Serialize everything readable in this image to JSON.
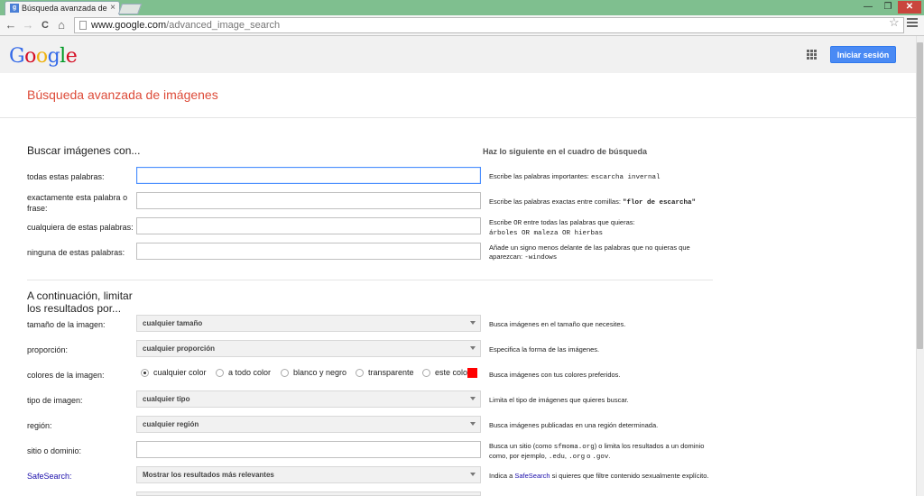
{
  "browser": {
    "tab_title": "Búsqueda avanzada de imágenes",
    "tab_favicon_letter": "g",
    "tab_close": "×",
    "url_domain": "www.google.com",
    "url_path": "/advanced_image_search",
    "controls": {
      "minimize": "—",
      "maximize": "❐",
      "close": "✕"
    },
    "nav": {
      "back": "←",
      "forward": "→",
      "reload": "C",
      "home": "⌂",
      "star": "☆"
    }
  },
  "header": {
    "logo_letters": [
      {
        "ch": "G",
        "color": "#3369e8"
      },
      {
        "ch": "o",
        "color": "#d50f25"
      },
      {
        "ch": "o",
        "color": "#eeb211"
      },
      {
        "ch": "g",
        "color": "#3369e8"
      },
      {
        "ch": "l",
        "color": "#009925"
      },
      {
        "ch": "e",
        "color": "#d50f25"
      }
    ],
    "signin_label": "Iniciar sesión"
  },
  "page_title": "Búsqueda avanzada de imágenes",
  "search_section": {
    "title": "Buscar imágenes con...",
    "hint_title": "Haz lo siguiente en el cuadro de búsqueda",
    "rows": [
      {
        "label": "todas estas palabras:",
        "hint_text": "Escribe las palabras importantes: ",
        "hint_code": "escarcha invernal"
      },
      {
        "label": "exactamente esta palabra o frase:",
        "hint_text": "Escribe las palabras exactas entre comillas: ",
        "hint_code": "\"flor de escarcha\""
      },
      {
        "label": "cualquiera de estas palabras:",
        "hint_pre": "Escribe ",
        "hint_or": "OR",
        "hint_post": " entre todas las palabras que quieras:",
        "hint_code": "árboles OR maleza OR hierbas"
      },
      {
        "label": "ninguna de estas palabras:",
        "hint_text": "Añade un signo menos delante de las palabras que no quieras que aparezcan: ",
        "hint_code": "-windows"
      }
    ]
  },
  "limit_section": {
    "title": "A continuación, limitar los resultados por...",
    "size": {
      "label": "tamaño de la imagen:",
      "value": "cualquier tamaño",
      "hint": "Busca imágenes en el tamaño que necesites."
    },
    "aspect": {
      "label": "proporción:",
      "value": "cualquier proporción",
      "hint": "Especifica la forma de las imágenes."
    },
    "colors": {
      "label": "colores de la imagen:",
      "options": [
        "cualquier color",
        "a todo color",
        "blanco y negro",
        "transparente",
        "este color:"
      ],
      "selected_index": 0,
      "swatch_color": "#ff0000",
      "hint": "Busca imágenes con tus colores preferidos."
    },
    "type": {
      "label": "tipo de imagen:",
      "value": "cualquier tipo",
      "hint": "Limita el tipo de imágenes que quieres buscar."
    },
    "region": {
      "label": "región:",
      "value": "cualquier región",
      "hint": "Busca imágenes publicadas en una región determinada."
    },
    "site": {
      "label": "sitio o dominio:",
      "hint_1": "Busca un sitio (como ",
      "hint_code_1": "sfmoma.org",
      "hint_2": ") o limita los resultados a un dominio como, por ejemplo, ",
      "hint_code_2": ".edu",
      "hint_3": ", ",
      "hint_code_3": ".org",
      "hint_4": " o ",
      "hint_code_4": ".gov",
      "hint_5": "."
    },
    "safesearch": {
      "label": "SafeSearch:",
      "value": "Mostrar los resultados más relevantes",
      "hint_pre": "Indica a ",
      "hint_link": "SafeSearch",
      "hint_post": " si quieres que filtre contenido sexualmente explícito."
    }
  }
}
